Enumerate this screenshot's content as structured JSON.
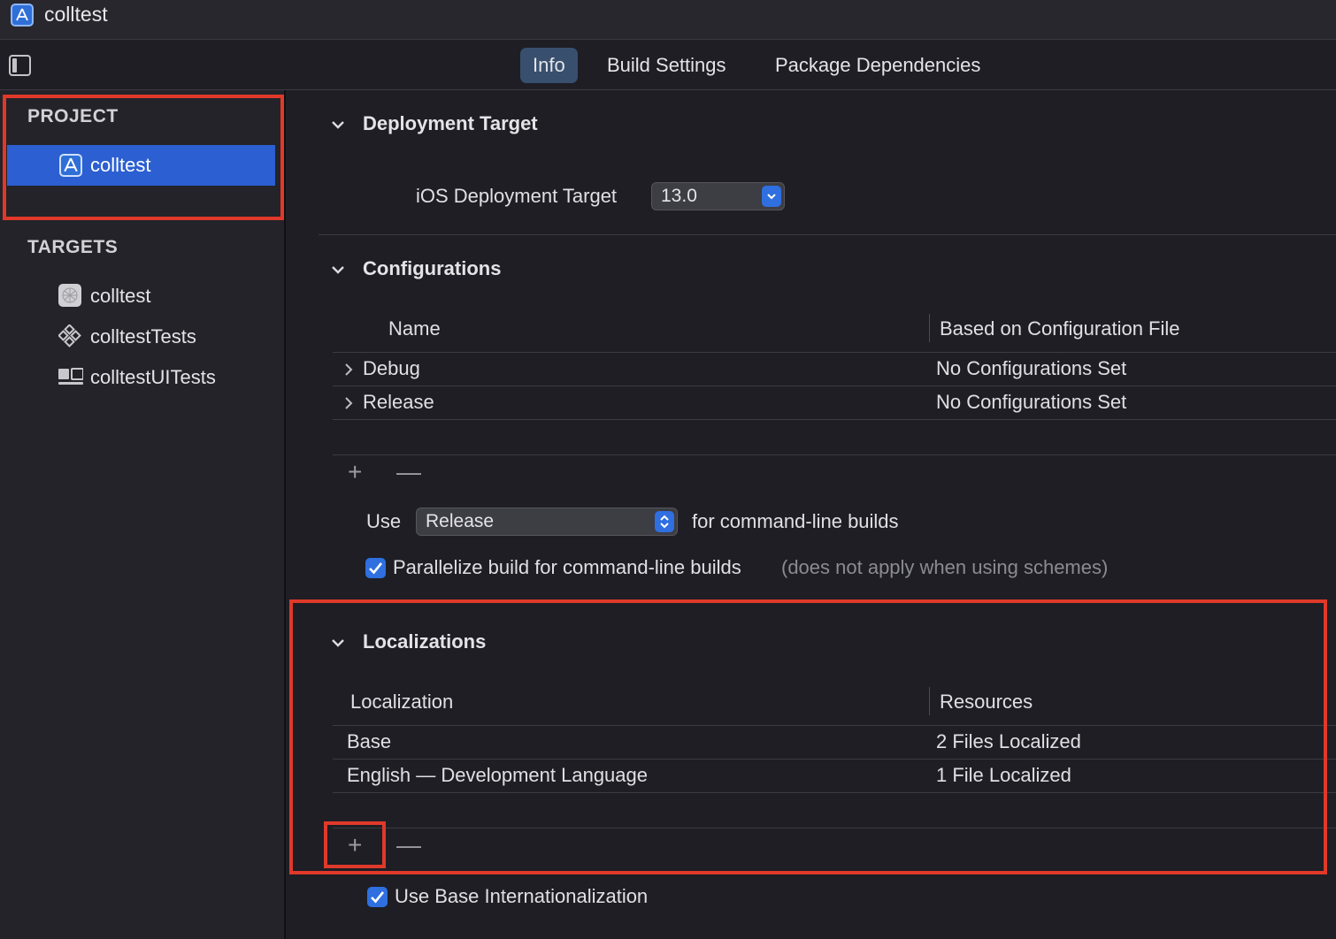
{
  "window": {
    "title": "colltest"
  },
  "tabs": [
    {
      "label": "Info",
      "active": true
    },
    {
      "label": "Build Settings",
      "active": false
    },
    {
      "label": "Package Dependencies",
      "active": false
    }
  ],
  "sidebar": {
    "project_header": "PROJECT",
    "project_item": "colltest",
    "targets_header": "TARGETS",
    "targets": [
      {
        "label": "colltest",
        "icon": "app-target-icon"
      },
      {
        "label": "colltestTests",
        "icon": "unit-test-icon"
      },
      {
        "label": "colltestUITests",
        "icon": "ui-test-icon"
      }
    ]
  },
  "deployment": {
    "title": "Deployment Target",
    "field_label": "iOS Deployment Target",
    "value": "13.0"
  },
  "configurations": {
    "title": "Configurations",
    "columns": [
      "Name",
      "Based on Configuration File"
    ],
    "rows": [
      {
        "name": "Debug",
        "file": "No Configurations Set"
      },
      {
        "name": "Release",
        "file": "No Configurations Set"
      }
    ],
    "add": "+",
    "remove": "—",
    "use_label": "Use",
    "use_value": "Release",
    "use_suffix": "for command-line builds",
    "parallelize_label": "Parallelize build for command-line builds",
    "parallelize_note": "(does not apply when using schemes)",
    "parallelize_checked": true
  },
  "localizations": {
    "title": "Localizations",
    "columns": [
      "Localization",
      "Resources"
    ],
    "rows": [
      {
        "name": "Base",
        "resources": "2 Files Localized"
      },
      {
        "name": "English — Development Language",
        "resources": "1 File Localized"
      }
    ],
    "add": "+",
    "remove": "—",
    "base_intl_label": "Use Base Internationalization",
    "base_intl_checked": true
  },
  "colors": {
    "accent": "#2f6fe0",
    "selection": "#2c5fd1",
    "highlight_box": "#e0392a"
  }
}
